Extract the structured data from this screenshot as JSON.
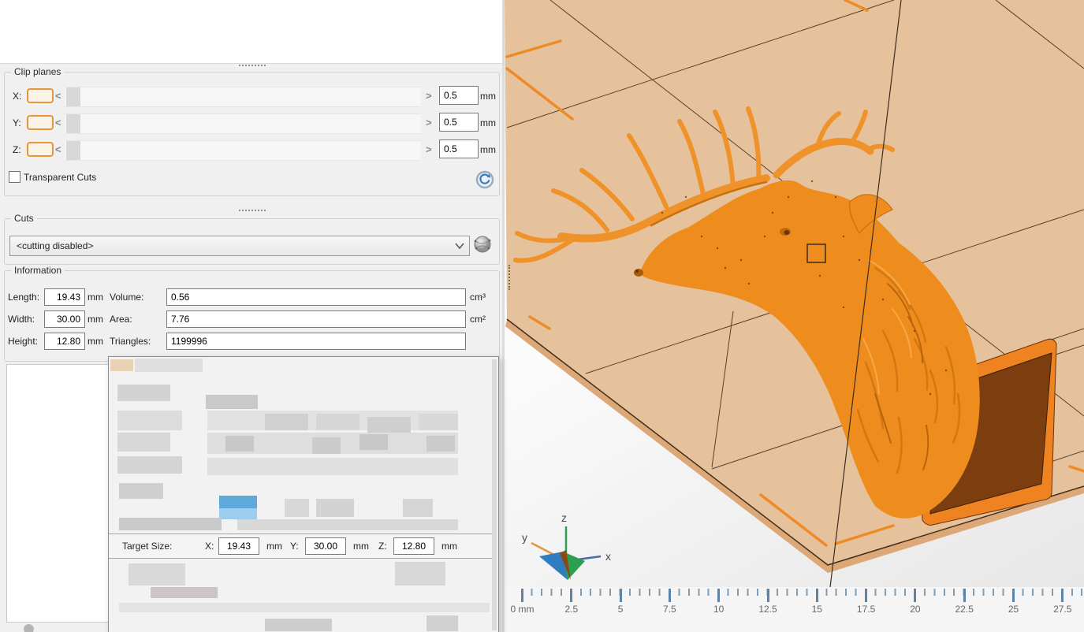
{
  "panel": {
    "clip_planes": {
      "title": "Clip planes",
      "left_arrow": "<",
      "right_arrow": ">",
      "rows": [
        {
          "axis": "X:",
          "value": "0.5",
          "unit": "mm"
        },
        {
          "axis": "Y:",
          "value": "0.5",
          "unit": "mm"
        },
        {
          "axis": "Z:",
          "value": "0.5",
          "unit": "mm"
        }
      ],
      "transparent_cuts_label": "Transparent Cuts"
    },
    "cuts": {
      "title": "Cuts",
      "dropdown_value": "<cutting disabled>"
    },
    "information": {
      "title": "Information",
      "fields": [
        {
          "label": "Length:",
          "value": "19.43",
          "unit": "mm"
        },
        {
          "label": "Width:",
          "value": "30.00",
          "unit": "mm"
        },
        {
          "label": "Height:",
          "value": "12.80",
          "unit": "mm"
        },
        {
          "label": "Volume:",
          "value": "0.56",
          "unit": "cm³"
        },
        {
          "label": "Area:",
          "value": "7.76",
          "unit": "cm²"
        },
        {
          "label": "Triangles:",
          "value": "1199996",
          "unit": ""
        }
      ]
    }
  },
  "dialog": {
    "target_size": {
      "label": "Target Size:",
      "fields": [
        {
          "axis": "X:",
          "value": "19.43",
          "unit": "mm"
        },
        {
          "axis": "Y:",
          "value": "30.00",
          "unit": "mm"
        },
        {
          "axis": "Z:",
          "value": "12.80",
          "unit": "mm"
        }
      ]
    }
  },
  "viewport": {
    "axes": {
      "x": "x",
      "y": "y",
      "z": "z"
    },
    "ruler": {
      "labels": [
        "0 mm",
        "2.5",
        "5",
        "7.5",
        "10",
        "12.5",
        "15",
        "17.5",
        "20",
        "22.5",
        "25",
        "27.5"
      ]
    },
    "colors": {
      "platform": "#e5c29b",
      "platform_side": "#dca877",
      "grid_line": "#473422",
      "accent_dash": "#ee8b26",
      "model_orange": "#ef8c1e",
      "slab_face": "#7d3e0f",
      "slab_rim": "#f08321",
      "axis_x": "#3f6fa5",
      "axis_y": "#e2953f",
      "axis_z": "#2f9e53",
      "ruler_tick": "#5b84a8",
      "highlight_blue": "#5fa8da"
    }
  }
}
